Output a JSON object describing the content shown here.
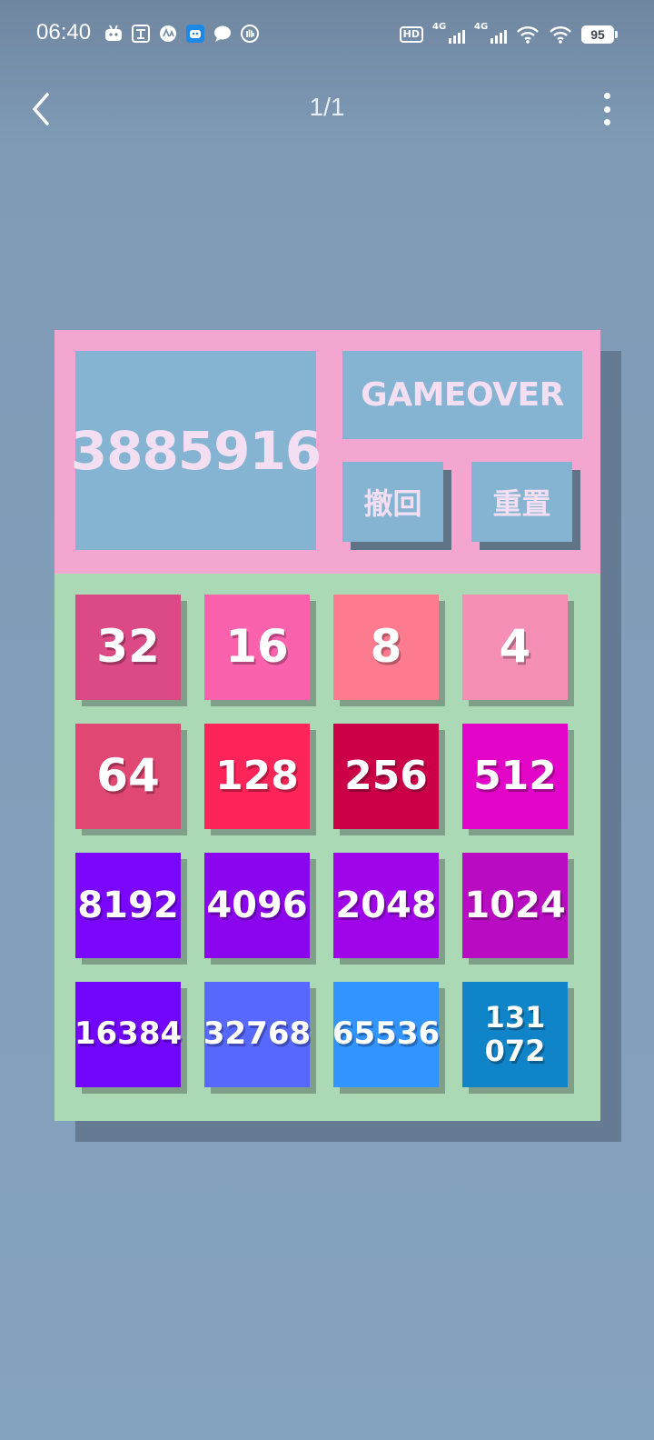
{
  "status_bar": {
    "time": "06:40",
    "notification_icons": [
      "bilibili-icon",
      "translate-icon",
      "ai-icon",
      "robot-icon",
      "chat-icon",
      "hand-icon"
    ],
    "network_hd": "HD",
    "signal1_label": "4G",
    "signal2_label": "4G",
    "battery": "95"
  },
  "nav": {
    "back_icon": "chevron-left-icon",
    "page_indicator": "1/1",
    "more_icon": "more-vertical-icon"
  },
  "game": {
    "score": "3885916",
    "status": "GAMEOVER",
    "undo_label": "撤回",
    "reset_label": "重置",
    "board": [
      [
        {
          "value": "32",
          "color": "#dc4a86"
        },
        {
          "value": "16",
          "color": "#fb62ae"
        },
        {
          "value": "8",
          "color": "#fd7a8f"
        },
        {
          "value": "4",
          "color": "#f58eb4"
        }
      ],
      [
        {
          "value": "64",
          "color": "#e04772"
        },
        {
          "value": "128",
          "color": "#fc2458"
        },
        {
          "value": "256",
          "color": "#cc0047"
        },
        {
          "value": "512",
          "color": "#e204c7"
        }
      ],
      [
        {
          "value": "8192",
          "color": "#7a06fb"
        },
        {
          "value": "4096",
          "color": "#8b05ee"
        },
        {
          "value": "2048",
          "color": "#a005ea"
        },
        {
          "value": "1024",
          "color": "#b90cc2"
        }
      ],
      [
        {
          "value": "16384",
          "color": "#7205fb"
        },
        {
          "value": "32768",
          "color": "#5768ff"
        },
        {
          "value": "65536",
          "color": "#3294ff"
        },
        {
          "value": "131\n072",
          "color": "#0f84c8"
        }
      ]
    ]
  }
}
